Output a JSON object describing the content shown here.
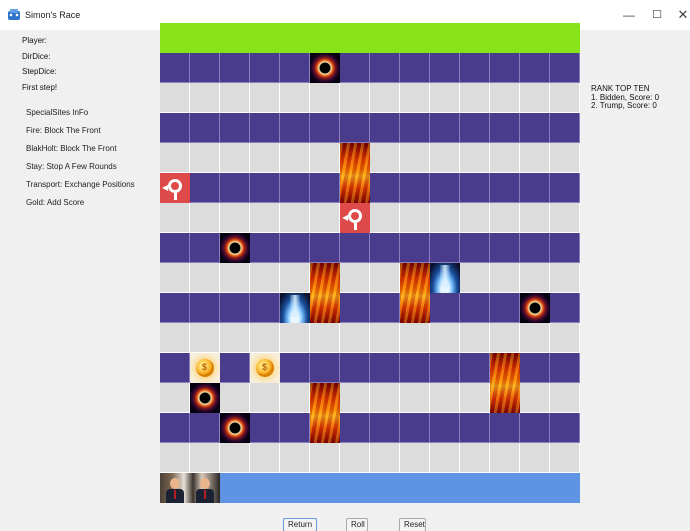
{
  "window": {
    "title": "Simon's Race",
    "controls": {
      "minimize": "—",
      "maximize": "☐",
      "close": "✕"
    }
  },
  "status": {
    "player_label": "Player:",
    "dir_dice_label": "DirDice:",
    "step_dice_label": "StepDice:",
    "message": "First step!"
  },
  "special_sites": {
    "heading": "SpecialSites InFo",
    "items": [
      "Fire: Block The Front",
      "BlakHolt: Block The Front",
      "Stay: Stop A Few Rounds",
      "Transport: Exchange Positions",
      "Gold: Add Score"
    ]
  },
  "rank": {
    "heading": "RANK TOP TEN",
    "entries": [
      "1. Bidden, Score: 0",
      "2. Trump, Score: 0"
    ]
  },
  "board": {
    "columns": 14,
    "rows": 15,
    "colors": {
      "goal": "#88e318",
      "start": "#5f93e4",
      "dark": "#4a3c8c",
      "light": "#dcdcdc",
      "transport": "#de4949"
    },
    "row_types": [
      "goal",
      "dark",
      "light",
      "dark",
      "light",
      "dark",
      "light",
      "dark",
      "light",
      "dark",
      "light",
      "dark",
      "light",
      "dark",
      "light",
      "start"
    ],
    "sites": [
      {
        "type": "blackhole",
        "row": 1,
        "col": 5
      },
      {
        "type": "fire",
        "row": 4,
        "col": 6,
        "span": 2
      },
      {
        "type": "transport",
        "row": 5,
        "col": 0
      },
      {
        "type": "transport",
        "row": 6,
        "col": 6
      },
      {
        "type": "blackhole",
        "row": 7,
        "col": 2
      },
      {
        "type": "fire",
        "row": 8,
        "col": 5,
        "span": 2
      },
      {
        "type": "fire",
        "row": 8,
        "col": 8,
        "span": 2
      },
      {
        "type": "stay",
        "row": 8,
        "col": 9
      },
      {
        "type": "stay",
        "row": 9,
        "col": 4
      },
      {
        "type": "blackhole",
        "row": 9,
        "col": 12
      },
      {
        "type": "gold",
        "row": 11,
        "col": 1
      },
      {
        "type": "gold",
        "row": 11,
        "col": 3
      },
      {
        "type": "fire",
        "row": 11,
        "col": 11,
        "span": 2
      },
      {
        "type": "blackhole",
        "row": 12,
        "col": 1
      },
      {
        "type": "fire",
        "row": 12,
        "col": 5,
        "span": 2
      },
      {
        "type": "blackhole",
        "row": 13,
        "col": 2
      }
    ]
  },
  "buttons": {
    "return_label": "Return",
    "roll_label": "Roll",
    "reset_label": "Reset"
  }
}
